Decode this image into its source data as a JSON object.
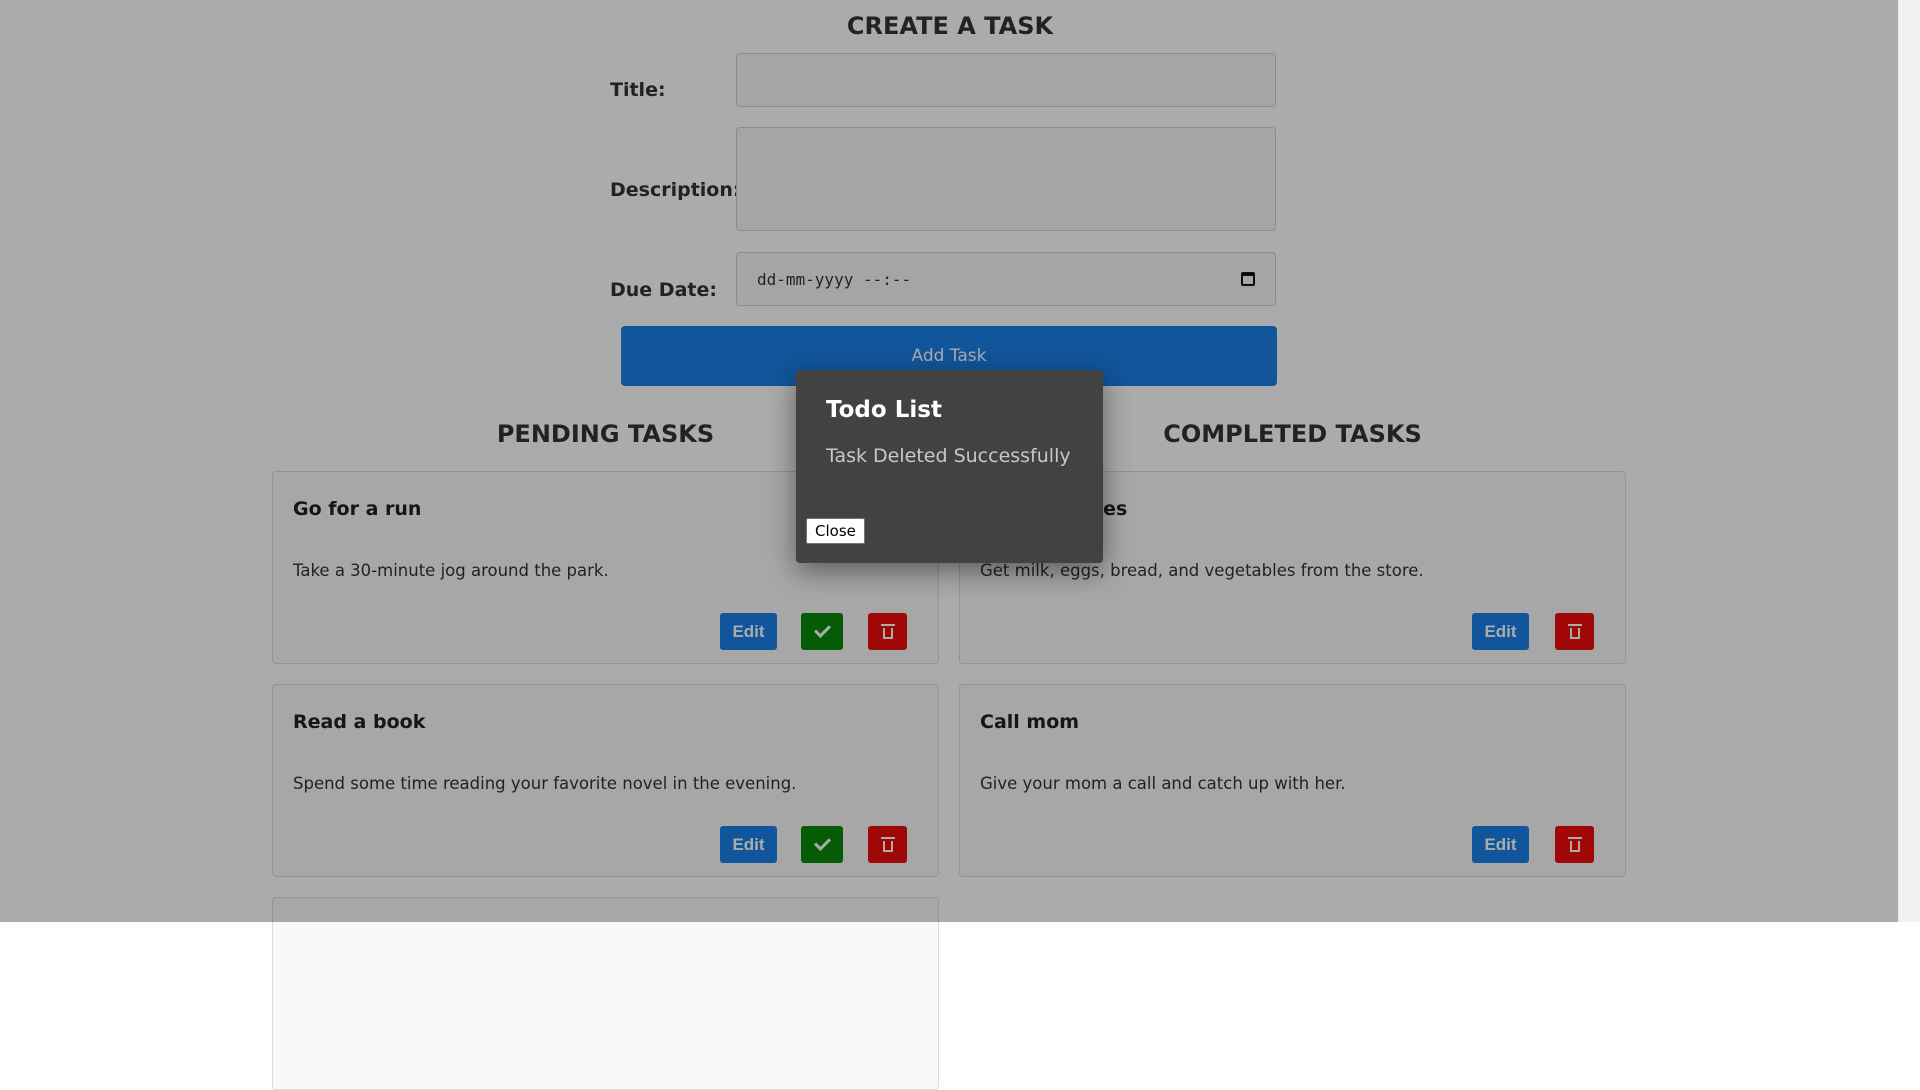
{
  "create_form": {
    "heading": "CREATE A TASK",
    "title_label": "Title:",
    "title_value": "",
    "description_label": "Description:",
    "description_value": "",
    "due_date_label": "Due Date:",
    "due_date_placeholder": "dd-mm-yyyy --:--",
    "add_button_label": "Add Task"
  },
  "pending": {
    "heading": "PENDING TASKS",
    "tasks": [
      {
        "title": "Go for a run",
        "description": "Take a 30-minute jog around the park.",
        "edit_label": "Edit"
      },
      {
        "title": "Read a book",
        "description": "Spend some time reading your favorite novel in the evening.",
        "edit_label": "Edit"
      }
    ]
  },
  "completed": {
    "heading": "COMPLETED TASKS",
    "tasks": [
      {
        "title": "Buy groceries",
        "description": "Get milk, eggs, bread, and vegetables from the store.",
        "edit_label": "Edit"
      },
      {
        "title": "Call mom",
        "description": "Give your mom a call and catch up with her.",
        "edit_label": "Edit"
      }
    ]
  },
  "modal": {
    "title": "Todo List",
    "message": "Task Deleted Successfully",
    "close_label": "Close"
  },
  "icons": {
    "complete": "check-icon",
    "delete": "trash-icon",
    "calendar": "calendar-icon"
  },
  "colors": {
    "primary": "#1a7fe8",
    "success": "#0a8a0a",
    "danger": "#ef0b0b",
    "modal_bg": "#424242"
  }
}
